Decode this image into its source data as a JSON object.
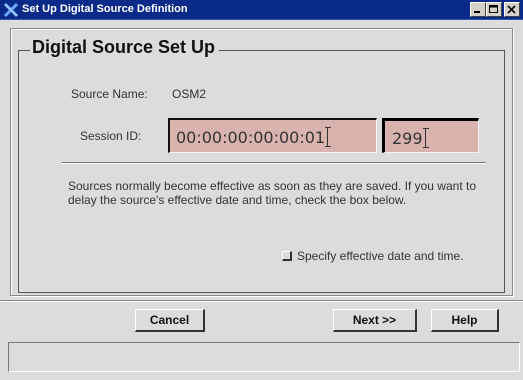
{
  "window": {
    "title": "Set Up Digital Source Definition",
    "controls": {
      "minimize": "minimize",
      "maximize": "maximize",
      "close": "close"
    }
  },
  "group": {
    "title": "Digital Source Set Up"
  },
  "source": {
    "label": "Source Name:",
    "value": "OSM2"
  },
  "session": {
    "label": "Session ID:",
    "value": "00:00:00:00:00:01",
    "suffix_value": "299"
  },
  "note": "Sources normally become effective as soon as they are saved.  If you want to delay the source's effective date and time, check the box below.",
  "effective_checkbox": {
    "label": "Specify effective date and time.",
    "checked": false
  },
  "buttons": {
    "cancel": "Cancel",
    "next": "Next >>",
    "help": "Help"
  },
  "status_bar": {
    "text": ""
  },
  "colors": {
    "titlebar": "#0a2a8a",
    "field_bg": "#d9b3ad",
    "window_bg": "#dcdcdc"
  }
}
